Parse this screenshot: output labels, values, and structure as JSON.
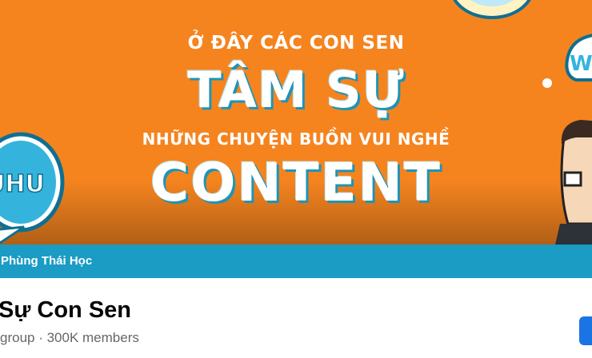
{
  "cover": {
    "line1": "Ở ĐÂY CÁC CON SEN",
    "line2": "TÂM SỰ",
    "line3": "NHỮNG CHUYỆN BUỒN VUI NGHỀ",
    "line4": "CONTENT",
    "sticker_left_text": "UHU",
    "sticker_right_text": "W"
  },
  "author_bar": {
    "text": "Phùng Thái Học"
  },
  "group": {
    "name": "Sự Con Sen",
    "meta": "group · 300K members"
  },
  "colors": {
    "cover_bg": "#f5841f",
    "accent_blue": "#1a9cc4",
    "button_blue": "#1b74e4"
  }
}
